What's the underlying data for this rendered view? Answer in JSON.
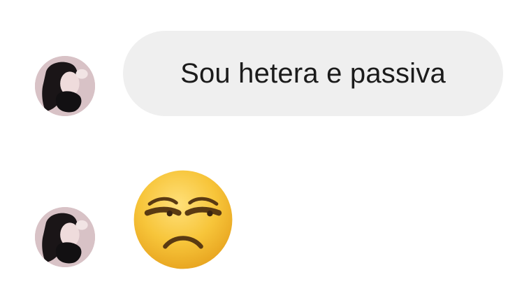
{
  "messages": [
    {
      "type": "text",
      "text": "Sou hetera e passiva",
      "avatar_icon": "user-avatar-photo"
    },
    {
      "type": "emoji",
      "emoji_icon": "unamused-face-emoji",
      "avatar_icon": "user-avatar-photo"
    }
  ],
  "colors": {
    "background": "#ffffff",
    "bubble": "#efefef",
    "text": "#1b1b1b",
    "emoji_face": "#f7c53a"
  }
}
